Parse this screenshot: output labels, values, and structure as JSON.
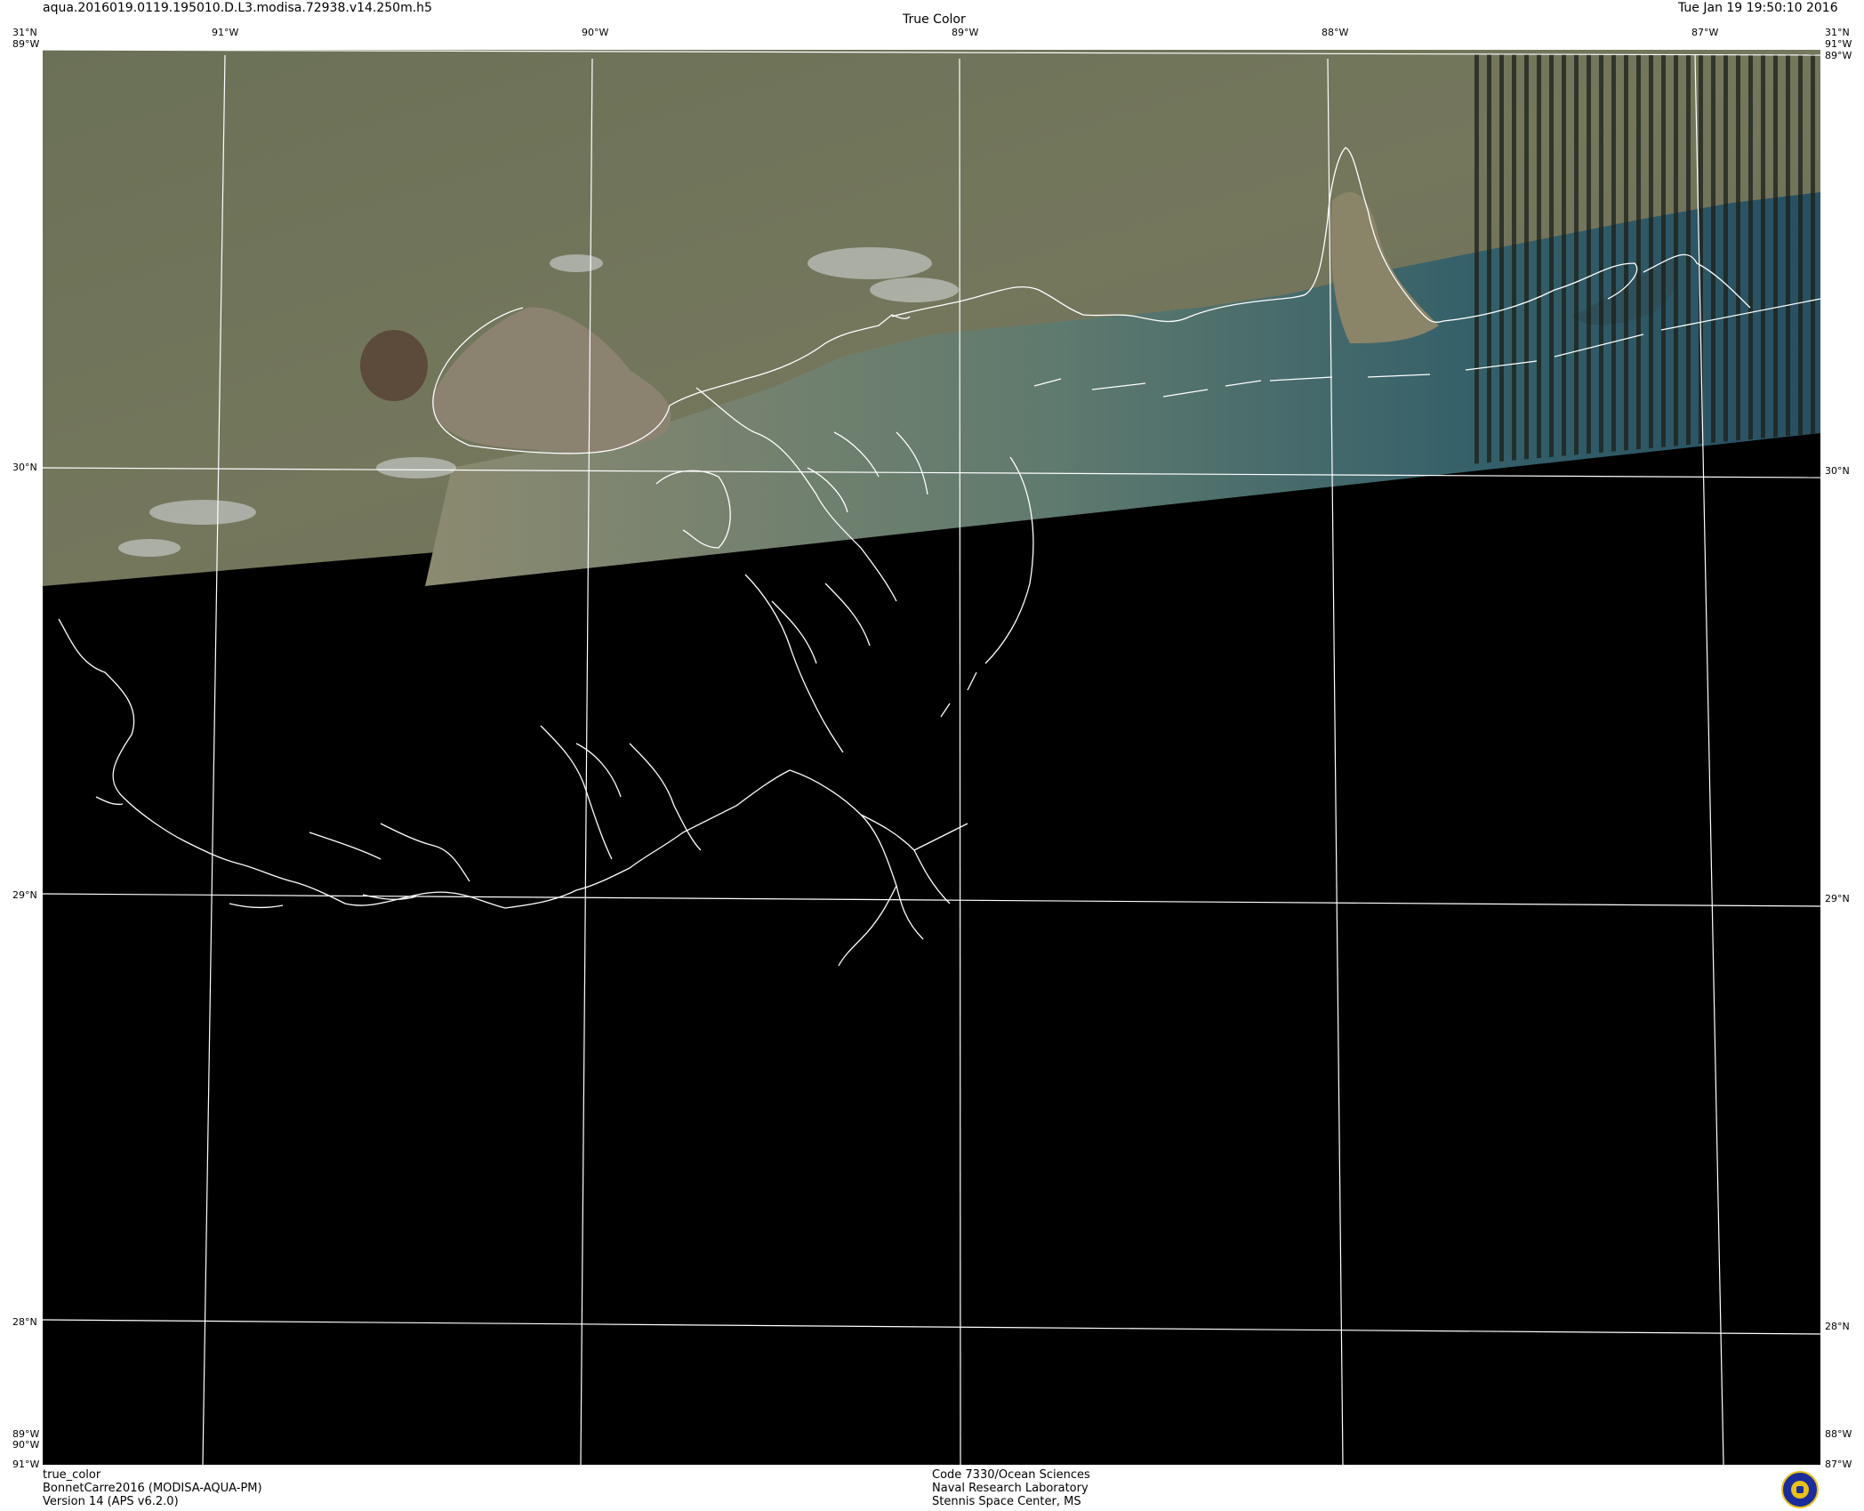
{
  "header": {
    "filename": "aqua.2016019.0119.195010.D.L3.modisa.72938.v14.250m.h5",
    "product_title": "True Color",
    "timestamp": "Tue Jan 19 19:50:10 2016"
  },
  "map": {
    "region": "Northern Gulf of Mexico coast (Louisiana / Mississippi / Alabama / Florida panhandle)",
    "top_lon_labels": [
      "91°W",
      "90°W",
      "89°W",
      "88°W",
      "87°W"
    ],
    "lat_labels": [
      "31°N",
      "30°N",
      "29°N",
      "28°N"
    ],
    "corner_labels": {
      "top_left_lat": "31°N",
      "top_left_lon": "89°W",
      "top_right_lat": "31°N",
      "top_right_lon_a": "91°W",
      "top_right_lon_b": "89°W",
      "bottom_left_lon_a": "89°W",
      "bottom_left_lon_b": "90°W",
      "bottom_left_lon_c": "91°W",
      "bottom_right_lon_a": "88°W",
      "bottom_right_lon_b": "87°W"
    },
    "colors": {
      "land": "#6f7458",
      "water_turbid": "#8a8a6e",
      "water_clear": "#2f5a66",
      "no_data": "#000000",
      "graticule": "#ffffff"
    }
  },
  "footer": {
    "left_line1": "true_color",
    "left_line2": "BonnetCarre2016 (MODISA-AQUA-PM)",
    "left_line3": "Version 14 (APS v6.2.0)",
    "center_line1": "Code 7330/Ocean Sciences",
    "center_line2": "Naval Research Laboratory",
    "center_line3": "Stennis Space Center, MS",
    "logo": "nrl-seal-icon"
  }
}
